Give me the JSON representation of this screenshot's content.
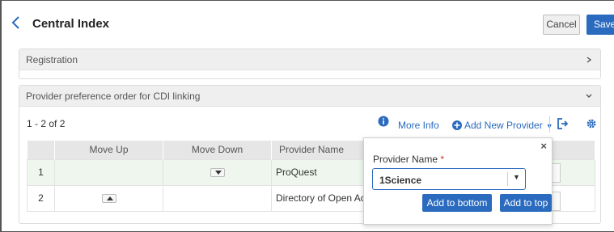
{
  "header": {
    "title": "Central Index",
    "cancel_label": "Cancel",
    "save_label": "Save"
  },
  "registration_panel": {
    "title": "Registration"
  },
  "provider_panel": {
    "title": "Provider preference order for CDI linking",
    "count": "1 - 2 of 2",
    "more_info_label": "More Info",
    "add_provider_label": "Add New Provider",
    "columns": [
      "",
      "Move Up",
      "Move Down",
      "Provider Name"
    ],
    "rows": [
      {
        "num": "1",
        "provider": "ProQuest",
        "can_move_up": false,
        "can_move_down": true
      },
      {
        "num": "2",
        "provider": "Directory of Open Acce",
        "can_move_up": true,
        "can_move_down": false
      }
    ]
  },
  "popover": {
    "field_label": "Provider Name",
    "required_mark": "*",
    "selected_value": "1Science",
    "add_bottom_label": "Add to bottom",
    "add_top_label": "Add to top",
    "close_symbol": "×"
  },
  "colors": {
    "accent": "#2a6bbf",
    "row_highlight": "#eef6ee",
    "header_bg": "#efefef"
  }
}
